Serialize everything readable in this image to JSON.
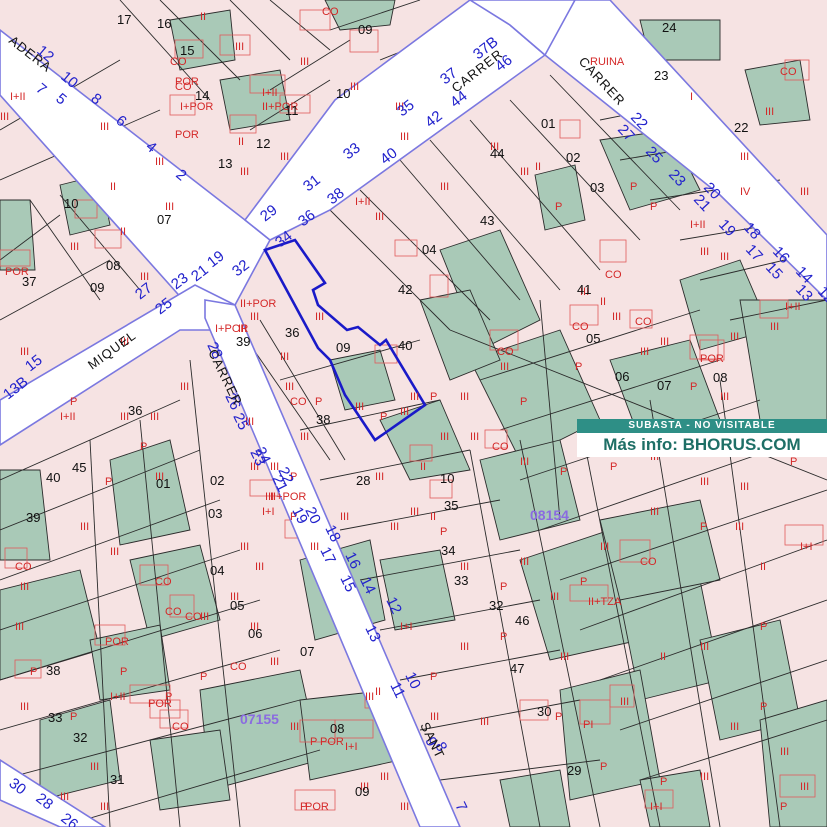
{
  "banner": {
    "status": "SUBASTA - NO VISITABLE",
    "info": "Más info: BHORUS.COM"
  },
  "block_ids": [
    "08154",
    "07155"
  ],
  "street_labels": [
    "ADERA",
    "CARRER",
    "CARRER",
    "MIQUEL",
    "CARRER",
    "SANT"
  ],
  "plot_numbers": [
    "17",
    "16",
    "09",
    "24",
    "23",
    "22",
    "15",
    "14",
    "11",
    "10",
    "12",
    "13",
    "01",
    "44",
    "02",
    "03",
    "43",
    "04",
    "42",
    "41",
    "05",
    "06",
    "07",
    "08",
    "09",
    "40",
    "36",
    "39",
    "38",
    "37",
    "10",
    "07",
    "08",
    "09",
    "36",
    "01",
    "02",
    "03",
    "04",
    "05",
    "06",
    "07",
    "08",
    "09",
    "10",
    "35",
    "34",
    "33",
    "32",
    "46",
    "47",
    "30",
    "29",
    "28",
    "45",
    "40",
    "39",
    "38",
    "33",
    "32",
    "31",
    "30"
  ],
  "house_numbers": [
    "12",
    "10",
    "8",
    "6",
    "4",
    "2",
    "7",
    "5",
    "29",
    "31",
    "33",
    "35",
    "37",
    "37B",
    "32",
    "34",
    "36",
    "38",
    "40",
    "42",
    "44",
    "46",
    "22",
    "20",
    "18",
    "16",
    "14",
    "12",
    "27",
    "25",
    "23",
    "21",
    "19",
    "17",
    "15",
    "13",
    "27",
    "25",
    "23",
    "21",
    "19",
    "28",
    "26",
    "24",
    "22",
    "20",
    "18",
    "16",
    "14",
    "12",
    "10",
    "8",
    "25",
    "23",
    "21",
    "19",
    "17",
    "15",
    "13",
    "11",
    "9",
    "7",
    "15",
    "13B",
    "30",
    "28",
    "26"
  ],
  "use_codes": [
    "P",
    "II",
    "III",
    "CO",
    "POR",
    "I+POR",
    "I+II",
    "II+POR",
    "IV",
    "I",
    "RUINA",
    "II+TZA",
    "PI",
    "I+I"
  ],
  "colors": {
    "background": "#f6e3e3",
    "green_parcel": "#a9c9b7",
    "street": "#ffffff",
    "street_border": "#7b78e0",
    "parcel_border": "#2b2b2b",
    "use_code": "#d42828",
    "house_number": "#2222cc",
    "target_outline": "#1a1ac8",
    "block_id": "#8a6be0",
    "banner_top": "#2e8f86",
    "banner_text": "#1e6f66"
  }
}
